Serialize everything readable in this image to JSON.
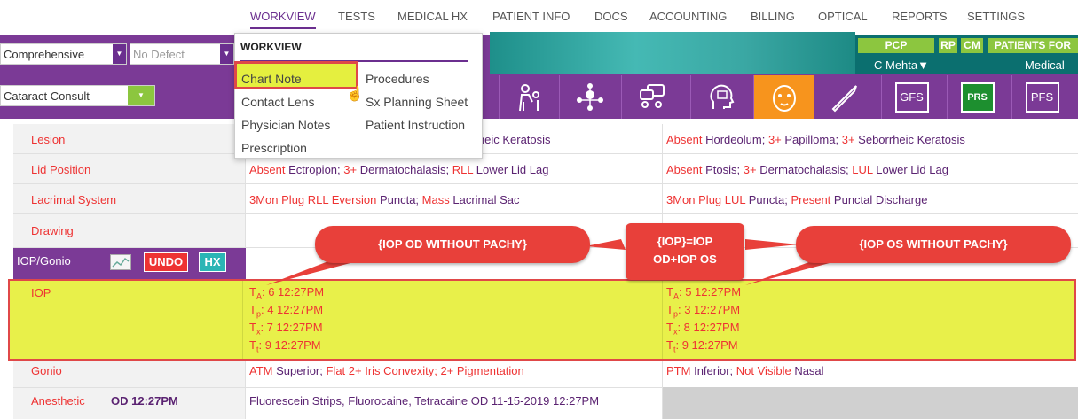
{
  "nav": {
    "items": [
      "WORKVIEW",
      "TESTS",
      "MEDICAL HX",
      "PATIENT INFO",
      "DOCS",
      "ACCOUNTING",
      "BILLING",
      "OPTICAL",
      "REPORTS",
      "SETTINGS"
    ],
    "active": "WORKVIEW"
  },
  "header": {
    "exam_type": "Comprehensive",
    "defect_placeholder": "No Defect",
    "visit_type": "Cataract Consult"
  },
  "teal_panel": {
    "pcp": "PCP",
    "rp": "RP",
    "cm": "CM",
    "patients_for": "PATIENTS FOR",
    "provider": "C Mehta▼",
    "category": "Medical"
  },
  "toolbar": {
    "gfs": "GFS",
    "prs": "PRS",
    "pfs": "PFS"
  },
  "dropdown": {
    "title": "WORKVIEW",
    "left_items": [
      "Chart Note",
      "Contact Lens",
      "Physician Notes",
      "Prescription"
    ],
    "right_items": [
      "Procedures",
      "Sx Planning Sheet",
      "Patient Instruction"
    ]
  },
  "rows": {
    "lesion": {
      "label": "Lesion",
      "od": "orrheic Keratosis",
      "os_a": "Absent",
      "os_b": "Hordeolum;",
      "os_c": "3+",
      "os_d": "Papilloma;",
      "os_e": "3+",
      "os_f": "Seborrheic Keratosis"
    },
    "lid": {
      "label": "Lid Position",
      "od_a": "Absent",
      "od_b": "Ectropion;",
      "od_c": "3+",
      "od_d": "Dermatochalasis;",
      "od_e": "RLL",
      "od_f": "Lower Lid Lag",
      "os_a": "Absent",
      "os_b": "Ptosis;",
      "os_c": "3+",
      "os_d": "Dermatochalasis;",
      "os_e": "LUL",
      "os_f": "Lower Lid Lag"
    },
    "lacrimal": {
      "label": "Lacrimal System",
      "od_a": "3Mon Plug RLL Eversion",
      "od_b": "Puncta;",
      "od_c": "Mass",
      "od_d": "Lacrimal Sac",
      "os_a": "3Mon Plug LUL",
      "os_b": "Puncta;",
      "os_c": "Present",
      "os_d": "Punctal Discharge"
    },
    "drawing": {
      "label": "Drawing"
    },
    "iop_gonio": {
      "label": "IOP/Gonio",
      "undo": "UNDO",
      "hx": "HX"
    },
    "iop": {
      "label": "IOP",
      "od": [
        {
          "sub": "A",
          "value": ": 6 12:27PM"
        },
        {
          "sub": "p",
          "value": ": 4 12:27PM"
        },
        {
          "sub": "x",
          "value": ": 7 12:27PM"
        },
        {
          "sub": "t",
          "value": ": 9 12:27PM"
        }
      ],
      "os": [
        {
          "sub": "A",
          "value": ": 5 12:27PM"
        },
        {
          "sub": "p",
          "value": ": 3 12:27PM"
        },
        {
          "sub": "x",
          "value": ": 8 12:27PM"
        },
        {
          "sub": "t",
          "value": ": 9 12:27PM"
        }
      ]
    },
    "gonio": {
      "label": "Gonio",
      "od_a": "ATM",
      "od_b": "Superior;",
      "od_c": "Flat 2+ Iris Convexity; 2+ Pigmentation",
      "os_a": "PTM",
      "os_b": "Inferior;",
      "os_c": "Not Visible",
      "os_d": "Nasal"
    },
    "anesthetic": {
      "label": "Anesthetic",
      "time": "OD 12:27PM",
      "od": "Fluorescein Strips, Fluorocaine, Tetracaine OD 11-15-2019 12:27PM"
    }
  },
  "callouts": {
    "od": "{IOP OD WITHOUT PACHY}",
    "mid_line1": "{IOP}=IOP",
    "mid_line2": "OD+IOP OS",
    "os": "{IOP OS WITHOUT PACHY}"
  }
}
